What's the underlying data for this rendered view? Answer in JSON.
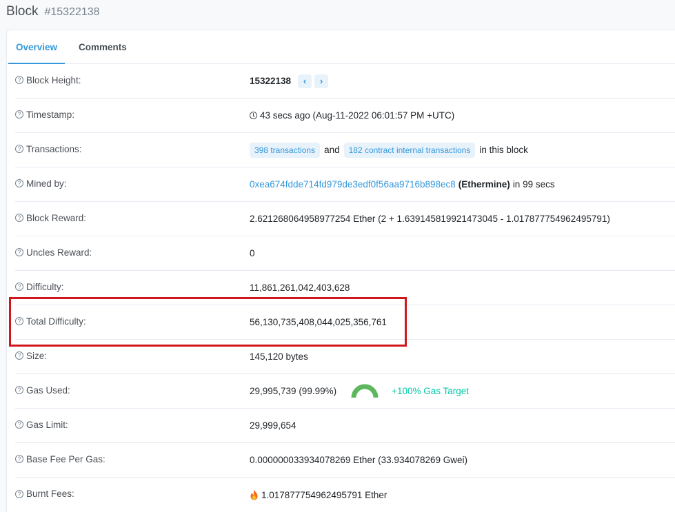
{
  "header": {
    "title": "Block",
    "block_number": "#15322138"
  },
  "tabs": [
    {
      "label": "Overview",
      "active": true
    },
    {
      "label": "Comments",
      "active": false
    }
  ],
  "rows": {
    "block_height": {
      "label": "Block Height:",
      "value": "15322138",
      "prev_glyph": "‹",
      "next_glyph": "›"
    },
    "timestamp": {
      "label": "Timestamp:",
      "value": "43 secs ago (Aug-11-2022 06:01:57 PM +UTC)"
    },
    "transactions": {
      "label": "Transactions:",
      "tx_badge": "398 transactions",
      "and_text": "and",
      "internal_badge": "182 contract internal transactions",
      "suffix": "in this block"
    },
    "mined_by": {
      "label": "Mined by:",
      "address": "0xea674fdde714fd979de3edf0f56aa9716b898ec8",
      "pool": "(Ethermine)",
      "suffix": "in 99 secs"
    },
    "block_reward": {
      "label": "Block Reward:",
      "value": "2.621268064958977254 Ether (2 + 1.639145819921473045 - 1.017877754962495791)"
    },
    "uncles_reward": {
      "label": "Uncles Reward:",
      "value": "0"
    },
    "difficulty": {
      "label": "Difficulty:",
      "value": "11,861,261,042,403,628"
    },
    "total_difficulty": {
      "label": "Total Difficulty:",
      "value": "56,130,735,408,044,025,356,761"
    },
    "size": {
      "label": "Size:",
      "value": "145,120 bytes"
    },
    "gas_used": {
      "label": "Gas Used:",
      "value": "29,995,739 (99.99%)",
      "gauge_fraction": 0.9999,
      "target": "+100% Gas Target"
    },
    "gas_limit": {
      "label": "Gas Limit:",
      "value": "29,999,654"
    },
    "base_fee": {
      "label": "Base Fee Per Gas:",
      "value": "0.000000033934078269 Ether (33.934078269 Gwei)"
    },
    "burnt_fees": {
      "label": "Burnt Fees:",
      "value": "1.017877754962495791 Ether"
    }
  },
  "icons": {
    "help": "question-circle-icon",
    "clock": "clock-icon",
    "flame": "flame-icon"
  },
  "colors": {
    "accent": "#3498db",
    "gas_target": "#00c9a7",
    "gauge": "#5cb85c",
    "highlight": "#d0151b"
  }
}
